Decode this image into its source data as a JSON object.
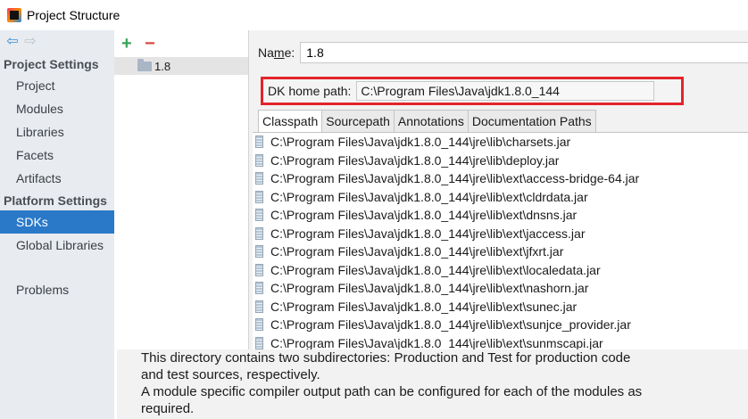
{
  "window": {
    "title": "Project Structure"
  },
  "sidebar": {
    "back_arrow": "⇦",
    "forward_arrow": "⇨",
    "project_settings_header": "Project Settings",
    "project_items": [
      "Project",
      "Modules",
      "Libraries",
      "Facets",
      "Artifacts"
    ],
    "platform_settings_header": "Platform Settings",
    "platform_items": [
      "SDKs",
      "Global Libraries"
    ],
    "selected_item": "SDKs",
    "problems_item": "Problems"
  },
  "tree": {
    "add_label": "+",
    "remove_label": "−",
    "items": [
      "1.8"
    ]
  },
  "detail": {
    "name_label_underlined": "m",
    "name_label_prefix": "Na",
    "name_label_suffix": "e:",
    "name_value": "1.8",
    "jdk_label": "DK home path:",
    "jdk_value": "C:\\Program Files\\Java\\jdk1.8.0_144",
    "tabs": [
      "Classpath",
      "Sourcepath",
      "Annotations",
      "Documentation Paths"
    ],
    "active_tab": "Classpath",
    "classpath": [
      "C:\\Program Files\\Java\\jdk1.8.0_144\\jre\\lib\\charsets.jar",
      "C:\\Program Files\\Java\\jdk1.8.0_144\\jre\\lib\\deploy.jar",
      "C:\\Program Files\\Java\\jdk1.8.0_144\\jre\\lib\\ext\\access-bridge-64.jar",
      "C:\\Program Files\\Java\\jdk1.8.0_144\\jre\\lib\\ext\\cldrdata.jar",
      "C:\\Program Files\\Java\\jdk1.8.0_144\\jre\\lib\\ext\\dnsns.jar",
      "C:\\Program Files\\Java\\jdk1.8.0_144\\jre\\lib\\ext\\jaccess.jar",
      "C:\\Program Files\\Java\\jdk1.8.0_144\\jre\\lib\\ext\\jfxrt.jar",
      "C:\\Program Files\\Java\\jdk1.8.0_144\\jre\\lib\\ext\\localedata.jar",
      "C:\\Program Files\\Java\\jdk1.8.0_144\\jre\\lib\\ext\\nashorn.jar",
      "C:\\Program Files\\Java\\jdk1.8.0_144\\jre\\lib\\ext\\sunec.jar",
      "C:\\Program Files\\Java\\jdk1.8.0_144\\jre\\lib\\ext\\sunjce_provider.jar",
      "C:\\Program Files\\Java\\jdk1.8.0_144\\jre\\lib\\ext\\sunmscapi.jar"
    ]
  },
  "tooltip": {
    "lines": [
      "This directory contains two subdirectories: Production and Test for production code",
      "and test sources, respectively.",
      "A module specific compiler output path can be configured for each of the modules as",
      "required."
    ]
  },
  "colors": {
    "selection": "#2a79c8",
    "highlight_box": "#e3242b",
    "add": "#3aa657",
    "remove": "#d9473b"
  }
}
